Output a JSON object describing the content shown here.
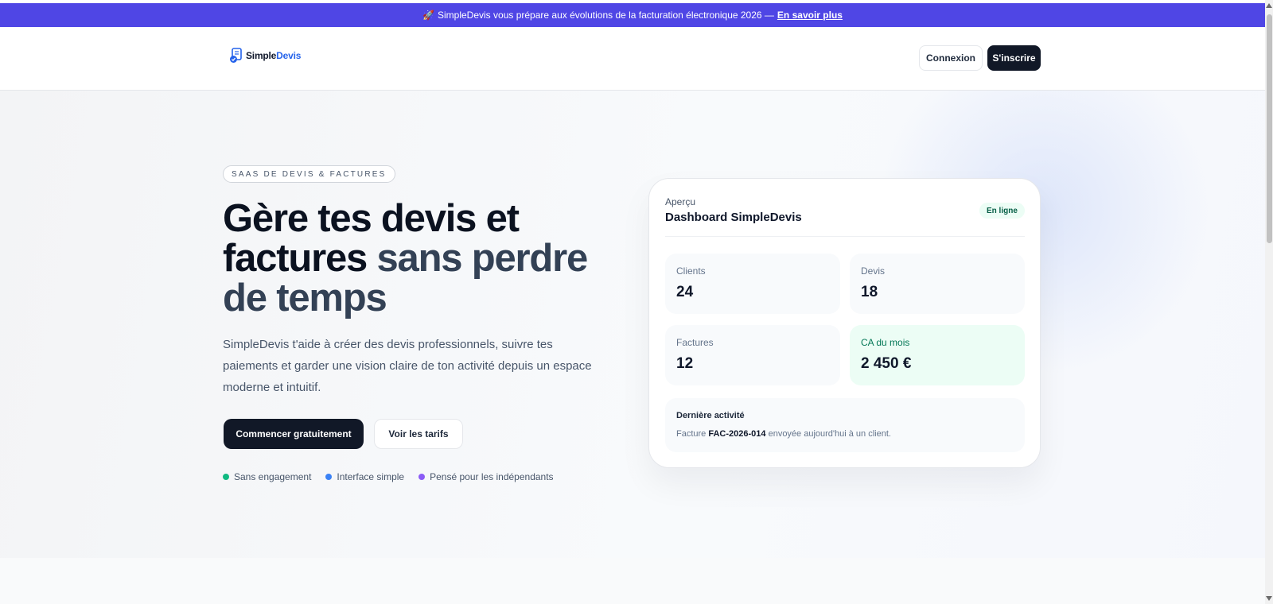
{
  "banner": {
    "emoji": "🚀",
    "text": "SimpleDevis vous prépare aux évolutions de la facturation électronique 2026 —",
    "link": "En savoir plus"
  },
  "header": {
    "logo_part1": "Simple",
    "logo_part2": "Devis",
    "login": "Connexion",
    "signup": "S'inscrire"
  },
  "hero": {
    "badge": "SAAS DE DEVIS & FACTURES",
    "title_dark": "Gère tes devis et factures",
    "title_accent": "sans perdre de temps",
    "description": "SimpleDevis t'aide à créer des devis professionnels, suivre tes paiements et garder une vision claire de ton activité depuis un espace moderne et intuitif.",
    "cta_primary": "Commencer gratuitement",
    "cta_secondary": "Voir les tarifs",
    "perks": [
      {
        "label": "Sans engagement",
        "color": "#10b981"
      },
      {
        "label": "Interface simple",
        "color": "#3b82f6"
      },
      {
        "label": "Pensé pour les indépendants",
        "color": "#8b5cf6"
      }
    ]
  },
  "card": {
    "eyebrow": "Aperçu",
    "title": "Dashboard SimpleDevis",
    "status": "En ligne",
    "stats": {
      "clients": {
        "label": "Clients",
        "value": "24"
      },
      "devis": {
        "label": "Devis",
        "value": "18"
      },
      "factures": {
        "label": "Factures",
        "value": "12"
      },
      "ca": {
        "label": "CA du mois",
        "value": "2 450 €"
      }
    },
    "activity": {
      "title": "Dernière activité",
      "prefix": "Facture",
      "invoice": "FAC-2026-014",
      "suffix": "envoyée aujourd'hui à un client."
    }
  },
  "colors": {
    "banner": "#4f46e5",
    "dark": "#111827",
    "accent_text": "#334155",
    "success_bg": "#ecfdf5"
  }
}
